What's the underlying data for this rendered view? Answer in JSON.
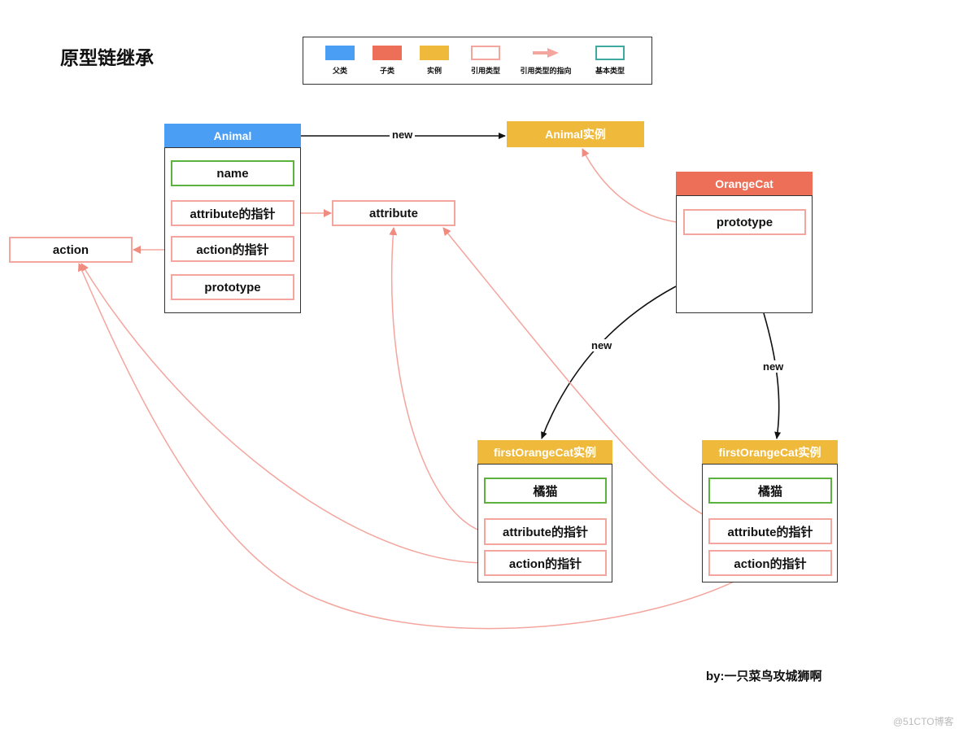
{
  "title": "原型链继承",
  "legend": [
    {
      "label": "父类",
      "kind": "fill",
      "color": "#4a9ff5"
    },
    {
      "label": "子类",
      "kind": "fill",
      "color": "#ee6f57"
    },
    {
      "label": "实例",
      "kind": "fill",
      "color": "#efba3c"
    },
    {
      "label": "引用类型",
      "kind": "outline",
      "color": "#f4a59d"
    },
    {
      "label": "引用类型的指向",
      "kind": "arrow",
      "color": "#f4a59d"
    },
    {
      "label": "基本类型",
      "kind": "outline",
      "color": "#3ea99f"
    }
  ],
  "colors": {
    "parent": "#4a9ff5",
    "child": "#ee6f57",
    "instance": "#efba3c",
    "reference": "#f4a59d",
    "primitive": "#5cb23f",
    "arrow_black": "#111111"
  },
  "animal": {
    "header": "Animal",
    "fields": [
      "name",
      "attribute的指针",
      "action的指针",
      "prototype"
    ]
  },
  "animal_instance": {
    "header": "Animal实例"
  },
  "attribute_box": {
    "label": "attribute"
  },
  "action_box": {
    "label": "action"
  },
  "orange_cat": {
    "header": "OrangeCat",
    "fields": [
      "prototype"
    ]
  },
  "instance1": {
    "header": "firstOrangeCat实例",
    "fields": [
      "橘猫",
      "attribute的指针",
      "action的指针"
    ]
  },
  "instance2": {
    "header": "firstOrangeCat实例",
    "fields": [
      "橘猫",
      "attribute的指针",
      "action的指针"
    ]
  },
  "edge_labels": {
    "animal_new": "new",
    "cat_new_1": "new",
    "cat_new_2": "new"
  },
  "author": "by:一只菜鸟攻城狮啊",
  "watermark": "@51CTO博客"
}
